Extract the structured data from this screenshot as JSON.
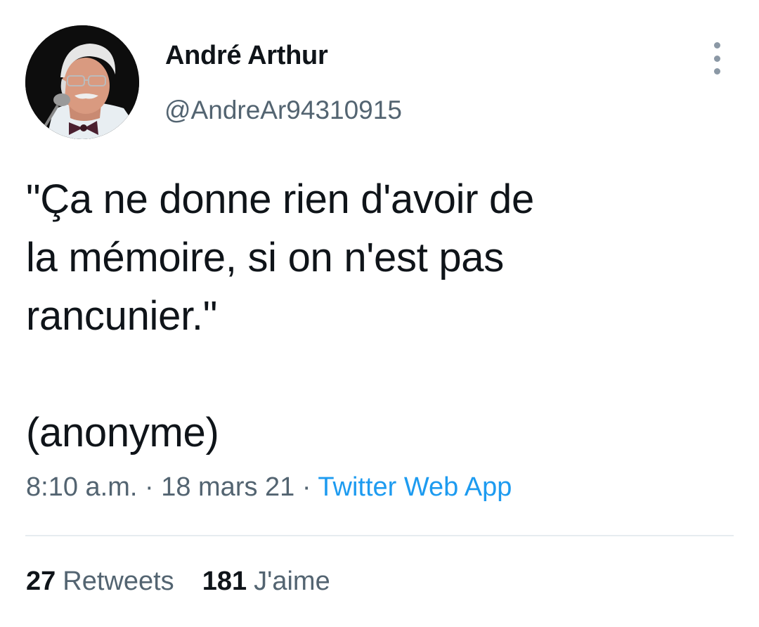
{
  "author": {
    "display_name": "André Arthur",
    "handle": "@AndreAr94310915",
    "avatar_icon": "profile-photo"
  },
  "tweet": {
    "text": "\"Ça ne donne rien d'avoir de\nla mémoire, si on n'est pas\nrancunier.\"\n\n(anonyme)"
  },
  "meta": {
    "time": "8:10 a.m.",
    "separator1": " · ",
    "date": "18 mars 21",
    "separator2": " · ",
    "source": "Twitter Web App"
  },
  "stats": {
    "retweets_count": "27",
    "retweets_label": "Retweets",
    "likes_count": "181",
    "likes_label": "J'aime"
  },
  "menu": {
    "more_icon": "more-vertical-icon"
  },
  "colors": {
    "text": "#0f1419",
    "secondary": "#536471",
    "link": "#1d9bf0",
    "divider": "#e6ecf0"
  }
}
